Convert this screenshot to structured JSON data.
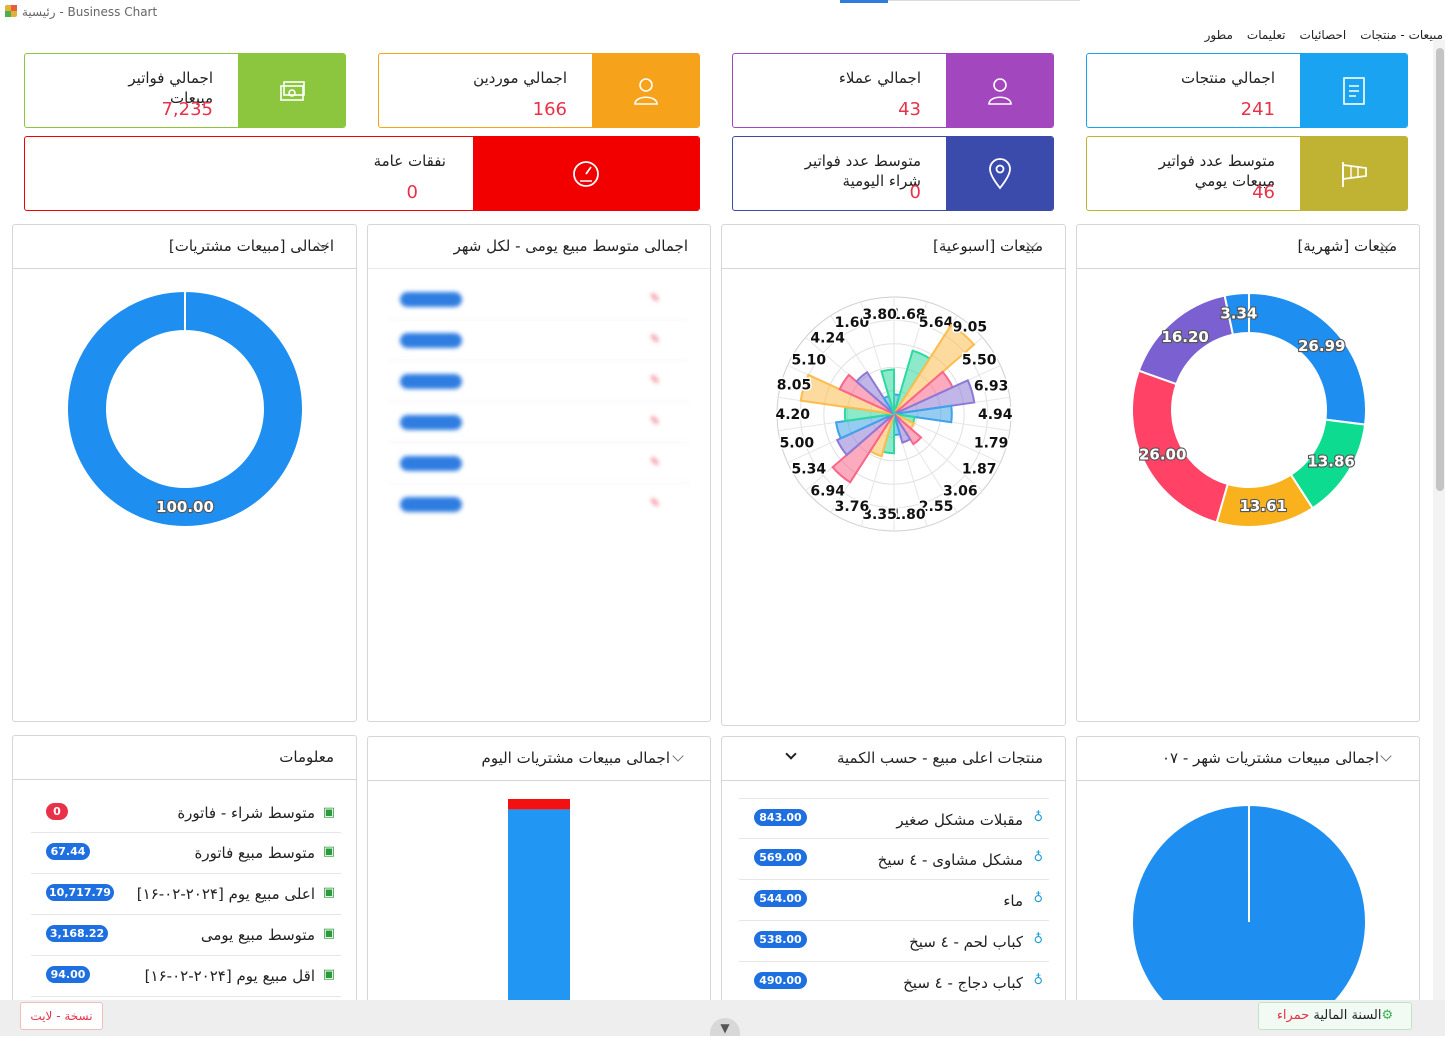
{
  "window": {
    "title": "رئيسية - Business Chart"
  },
  "menu": [
    "مبيعات - منتجات",
    "احصائيات",
    "تعليمات",
    "مطور"
  ],
  "colors": {
    "green": "#8cc63f",
    "orange": "#f7a21b",
    "purple": "#a347be",
    "blue": "#1aa3f0",
    "red": "#f20000",
    "navy": "#3a4bab",
    "olive": "#c0b232",
    "accent": "#e8324a"
  },
  "stats": [
    {
      "label": "اجمالي فواتير مبيعات",
      "value": "7,235",
      "icon": "cash-icon"
    },
    {
      "label": "اجمالي موردين",
      "value": "166",
      "icon": "user-icon"
    },
    {
      "label": "اجمالي عملاء",
      "value": "43",
      "icon": "user-icon"
    },
    {
      "label": "اجمالي منتجات",
      "value": "241",
      "icon": "document-icon"
    },
    {
      "label": "نفقات عامة",
      "value": "0",
      "icon": "speedometer-icon"
    },
    {
      "label": "متوسط عدد فواتير شراء اليومية",
      "value": "0",
      "icon": "location-pin-icon"
    },
    {
      "label": "متوسط عدد فواتير مبيعات يومي",
      "value": "46",
      "icon": "windsock-icon"
    }
  ],
  "panels": {
    "purchase_sales": {
      "title": "اجمالی [مبیعات مشتریات]"
    },
    "avg_daily": {
      "title": "اجمالی متوسط مبیع یومی - لکل شهر"
    },
    "weekly": {
      "title": "مبیعات [اسبوعیة]"
    },
    "monthly": {
      "title": "مبیعات [شهریة]"
    },
    "info": {
      "title": "معلومات"
    },
    "today": {
      "title": "اجمالی مبیعات مشتریات الیوم"
    },
    "top_products": {
      "title": "منتجات اعلى مبیع - حسب الکمیة"
    },
    "month07": {
      "title": "اجمالی مبیعات مشتریات شهر - ۰۷"
    }
  },
  "info_rows": [
    {
      "label": "متوسط شراء - فاتورة",
      "badge": "0",
      "badge_color": "#e8324a"
    },
    {
      "label": "متوسط مبیع فاتورة",
      "badge": "67.44",
      "badge_color": "#1e6fe0"
    },
    {
      "label": "اعلى مبیع یوم [۲۰۲۴-۰۲-۱۶]",
      "badge": "10,717.79",
      "badge_color": "#1e6fe0"
    },
    {
      "label": "متوسط مبیع یومی",
      "badge": "3,168.22",
      "badge_color": "#1e6fe0"
    },
    {
      "label": "اقل مبیع یوم [۲۰۲۴-۰۲-۱۶]",
      "badge": "94.00",
      "badge_color": "#1e6fe0"
    }
  ],
  "top_products": [
    {
      "name": "مقبلات مشکل صغیر",
      "qty": "843.00"
    },
    {
      "name": "مشکل مشاوی - ٤ سیخ",
      "qty": "569.00"
    },
    {
      "name": "ماء",
      "qty": "544.00"
    },
    {
      "name": "کباب لحم - ٤ سیخ",
      "qty": "538.00"
    },
    {
      "name": "کباب دجاج - ٤ سیخ",
      "qty": "490.00"
    }
  ],
  "footer": {
    "version": "نسخة - لایت",
    "fiscal_label": "السنة المالیة",
    "fiscal_value": "حمراء"
  },
  "chart_data": [
    {
      "type": "pie",
      "title": "مبیعات [شهریة]",
      "donut": true,
      "labels": [
        "26.99",
        "13.86",
        "13.61",
        "26.00",
        "16.20",
        "3.34"
      ],
      "values": [
        26.99,
        13.86,
        13.61,
        26.0,
        16.2,
        3.34
      ],
      "colors": [
        "#1e8ff0",
        "#0ddc90",
        "#f9b21e",
        "#ff4266",
        "#7b60d1",
        "#1e8ff0"
      ]
    },
    {
      "type": "polar",
      "title": "مبیعات [اسبوعیة]",
      "values": [
        1.68,
        5.64,
        9.05,
        5.5,
        6.93,
        4.94,
        1.79,
        1.87,
        3.06,
        2.55,
        1.8,
        3.35,
        3.76,
        6.94,
        5.34,
        5.0,
        4.2,
        8.05,
        5.1,
        4.24,
        1.6,
        3.8
      ],
      "colors": [
        "#3fa2e8",
        "#2ed8a0",
        "#fbbd4e",
        "#f9668a",
        "#8c7ad6",
        "#3fa2e8",
        "#2ed8a0",
        "#fbbd4e",
        "#f9668a",
        "#8c7ad6",
        "#3fa2e8",
        "#2ed8a0",
        "#fbbd4e",
        "#f9668a",
        "#8c7ad6",
        "#3fa2e8",
        "#2ed8a0",
        "#fbbd4e",
        "#f9668a",
        "#8c7ad6",
        "#3fa2e8",
        "#2ed8a0"
      ],
      "rmax": 10
    },
    {
      "type": "pie",
      "title": "اجمالی [مبیعات مشتریات]",
      "donut": true,
      "labels": [
        "100.00"
      ],
      "values": [
        100.0
      ],
      "colors": [
        "#1e8ff0"
      ]
    },
    {
      "type": "bar",
      "title": "اجمالی مبیعات مشتریات الیوم",
      "stacked": true,
      "series": [
        {
          "values": [
            95
          ],
          "color": "#2196f3"
        },
        {
          "values": [
            5
          ],
          "color": "#f21010"
        }
      ]
    },
    {
      "type": "pie",
      "title": "اجمالی مبیعات مشتریات شهر - ۰۷",
      "donut": false,
      "values": [
        100.0
      ],
      "colors": [
        "#1e8ff0"
      ]
    }
  ]
}
